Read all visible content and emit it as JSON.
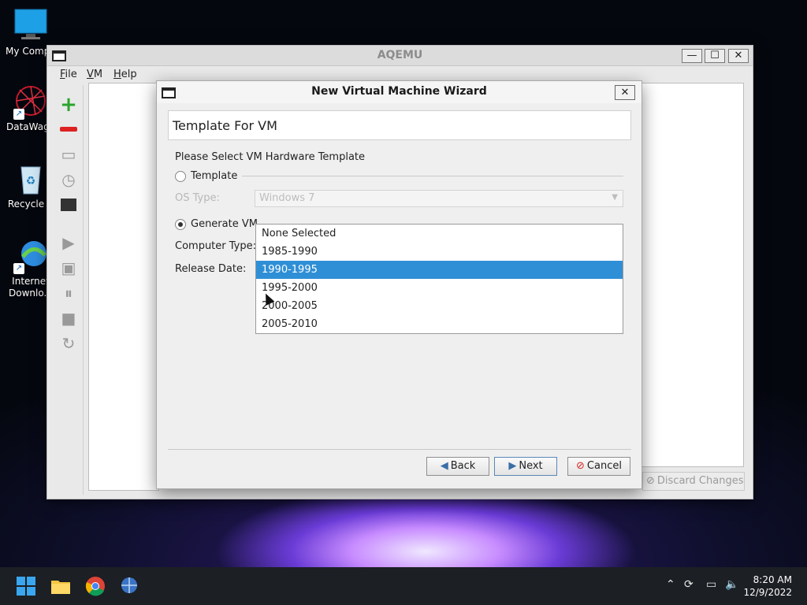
{
  "desktop": {
    "icons": [
      {
        "label": "My Compu"
      },
      {
        "label": "DataWago"
      },
      {
        "label": "Recycle B"
      },
      {
        "label": "Internet Downlo..."
      }
    ]
  },
  "main_window": {
    "title": "AQEMU",
    "menu": [
      {
        "label": "File",
        "mnemonic": "F"
      },
      {
        "label": "VM",
        "mnemonic": "V"
      },
      {
        "label": "Help",
        "mnemonic": "H"
      }
    ],
    "discard_label": "Discard Changes"
  },
  "wizard": {
    "title": "New Virtual Machine Wizard",
    "header": "Template For VM",
    "prompt": "Please Select VM Hardware Template",
    "template_radio": "Template",
    "os_type_label": "OS Type:",
    "os_type_value": "Windows 7",
    "generate_radio": "Generate VM",
    "computer_type_label": "Computer Type:",
    "release_date_label": "Release Date:",
    "dropdown_options": [
      "None Selected",
      "1985-1990",
      "1990-1995",
      "1995-2000",
      "2000-2005",
      "2005-2010"
    ],
    "selected_option": "1990-1995",
    "back_label": "Back",
    "next_label": "Next",
    "cancel_label": "Cancel"
  },
  "taskbar": {
    "time": "8:20 AM",
    "date": "12/9/2022"
  },
  "colors": {
    "selection": "#2f8fd6",
    "taskbar": "#1c1f24"
  }
}
